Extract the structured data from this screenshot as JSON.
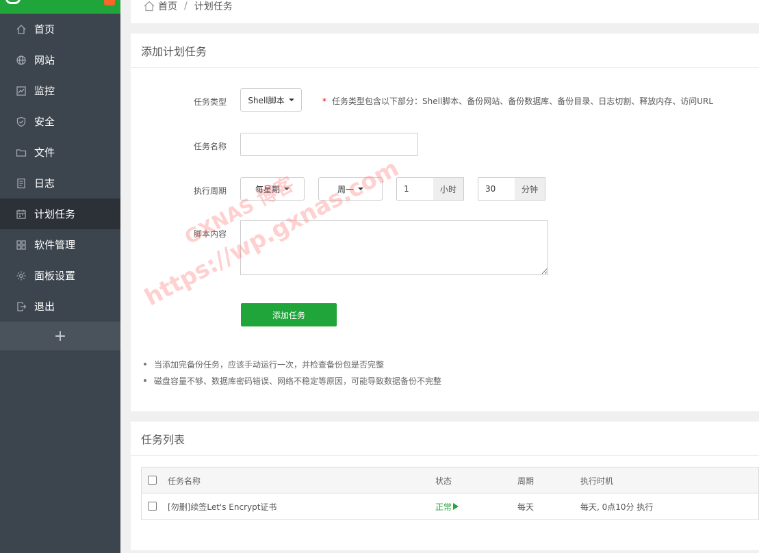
{
  "sidebar": {
    "items": [
      {
        "label": "首页",
        "icon": "home-icon"
      },
      {
        "label": "网站",
        "icon": "globe-icon"
      },
      {
        "label": "监控",
        "icon": "monitor-icon"
      },
      {
        "label": "安全",
        "icon": "shield-icon"
      },
      {
        "label": "文件",
        "icon": "folder-icon"
      },
      {
        "label": "日志",
        "icon": "log-icon"
      },
      {
        "label": "计划任务",
        "icon": "calendar-icon"
      },
      {
        "label": "软件管理",
        "icon": "apps-icon"
      },
      {
        "label": "面板设置",
        "icon": "gear-icon"
      },
      {
        "label": "退出",
        "icon": "logout-icon"
      }
    ],
    "add_symbol": "+"
  },
  "breadcrumb": {
    "home": "首页",
    "separator": "/",
    "current": "计划任务"
  },
  "form": {
    "title": "添加计划任务",
    "task_type_label": "任务类型",
    "task_type_value": "Shell脚本",
    "task_type_hint_star": "*",
    "task_type_hint": "任务类型包含以下部分：Shell脚本、备份网站、备份数据库、备份目录、日志切割、释放内存、访问URL",
    "task_name_label": "任务名称",
    "task_name_value": "",
    "period_label": "执行周期",
    "period_value": "每星期",
    "weekday_value": "周一",
    "hour_value": "1",
    "hour_unit": "小时",
    "minute_value": "30",
    "minute_unit": "分钟",
    "script_label": "脚本内容",
    "add_button": "添加任务",
    "tips": [
      "当添加完备份任务，应该手动运行一次，并检查备份包是否完整",
      "磁盘容量不够、数据库密码错误、网络不稳定等原因，可能导致数据备份不完整"
    ]
  },
  "task_list": {
    "title": "任务列表",
    "columns": [
      "任务名称",
      "状态",
      "周期",
      "执行时机"
    ],
    "rows": [
      {
        "name": "[勿删]续签Let's Encrypt证书",
        "status": "正常",
        "period": "每天",
        "timing": "每天, 0点10分 执行"
      }
    ]
  },
  "watermark": {
    "line1": "GXNAS 博客",
    "line2": "https://wp.gxnas.com"
  },
  "colors": {
    "brand": "#20a53a",
    "sidebar": "#3c444d",
    "sidebar_active": "#2c3138",
    "badge": "#f7672a"
  }
}
